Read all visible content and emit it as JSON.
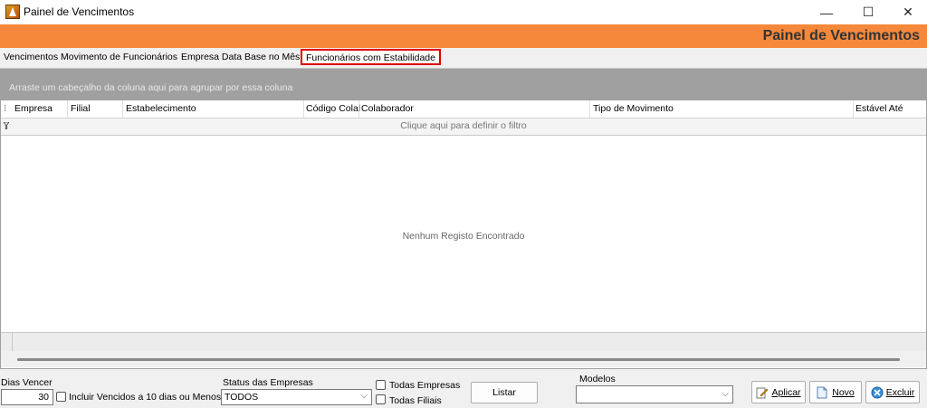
{
  "window": {
    "title": "Painel de Vencimentos",
    "minimize": "—",
    "maximize": "☐",
    "close": "✕"
  },
  "header": {
    "title": "Painel de Vencimentos",
    "accent_color": "#f5883a"
  },
  "tabs": [
    {
      "label": "Vencimentos Movimento de Funcionários"
    },
    {
      "label": "Empresa Data Base no Mês"
    },
    {
      "label": "Funcionários com Estabilidade",
      "active": true
    }
  ],
  "grid": {
    "group_hint": "Arraste um cabeçalho da coluna aqui para agrupar por essa coluna",
    "columns": [
      "Empresa",
      "Filial",
      "Estabelecimento",
      "Código Colal",
      "Colaborador",
      "Tipo de Movimento",
      "Estável Até"
    ],
    "filter_hint": "Clique aqui para definir o filtro",
    "empty_message": "Nenhum Registo Encontrado"
  },
  "bottom": {
    "dias_vencer_label": "Dias Vencer",
    "dias_vencer_value": "30",
    "incluir_vencidos_label": "Incluir Vencidos a 10 dias ou Menos",
    "status_label": "Status das Empresas",
    "status_value": "TODOS",
    "todas_empresas_label": "Todas Empresas",
    "todas_filiais_label": "Todas Filiais",
    "listar_label": "Listar",
    "modelos_label": "Modelos",
    "modelos_value": "",
    "aplicar_label": "Aplicar",
    "novo_label": "Novo",
    "excluir_label": "Excluir"
  }
}
